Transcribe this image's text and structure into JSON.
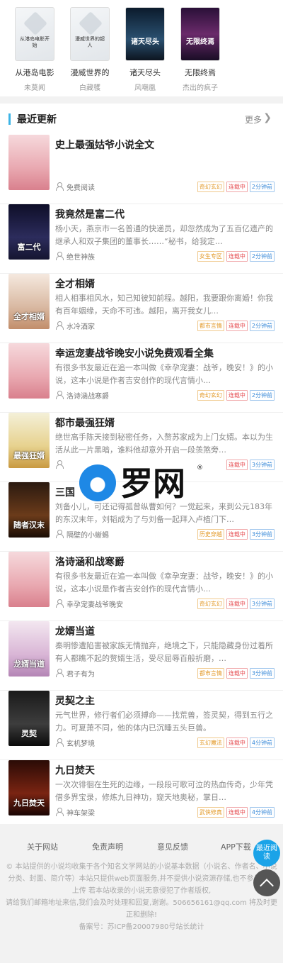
{
  "top_books": [
    {
      "title": "从港岛电影",
      "author": "未莫闻",
      "cover_text": "从港岛电影开始"
    },
    {
      "title": "漫威世界的",
      "author": "白藏鹱",
      "cover_text": "漫威世界的超人"
    },
    {
      "title": "诸天尽头",
      "author": "风嘲凰",
      "cover_text": "诸天尽头"
    },
    {
      "title": "无限终焉",
      "author": "杰出的疯子",
      "cover_text": "无限终焉"
    }
  ],
  "section": {
    "title": "最近更新",
    "more": "更多"
  },
  "books": [
    {
      "title": "史上最强姑爷小说全文",
      "desc": "",
      "author": "免费阅读",
      "category": "奇幻玄幻",
      "status": "连载中",
      "time": "2分钟前",
      "cover_text": ""
    },
    {
      "title": "我竟然是富二代",
      "desc": "杨小天，燕京市一名普通的快递员，却忽然成为了五百亿遗产的继承人和双子集团的董事长……“秘书，给我定…",
      "author": "绝世神族",
      "category": "女生专区",
      "status": "连载中",
      "time": "2分钟前",
      "cover_text": "富二代"
    },
    {
      "title": "全才相婿",
      "desc": "相人相事相风水，知己知彼知前程。越阳，我要跟你离婚！你我有百年姻缘，天命不可违。越阳，离开我女儿…",
      "author": "水冷酒家",
      "category": "都市言情",
      "status": "连载中",
      "time": "2分钟前",
      "cover_text": "全才相婿"
    },
    {
      "title": "幸运宠妻战爷晚安小说免费观看全集",
      "desc": "有很多书友最近在追一本叫做《幸孕宠妻：战爷，晚安！》的小说，这本小说是作者吉安创作的现代言情小…",
      "author": "洛诗涵战寒爵",
      "category": "奇幻玄幻",
      "status": "连载中",
      "time": "2分钟前",
      "cover_text": ""
    },
    {
      "title": "都市最强狂婿",
      "desc": "绝世高手陈天接到秘密任务，入赘苏家成为上门女婿。本以为生活从此一片黑暗，谁料他却意外开启一段羡煞旁…",
      "author": "",
      "category": "",
      "status": "连载中",
      "time": "3分钟前",
      "cover_text": "最强狂婿"
    },
    {
      "title": "三国",
      "desc": "刘备小儿，可还记得孤曾纵曹如何？一觉起来，来到公元183年的东汉末年，刘韬成为了与刘备一起拜入卢植门下…",
      "author": "隔壁的小蜥蜴",
      "category": "历史穿越",
      "status": "连载中",
      "time": "3分钟前",
      "cover_text": "随者汉末"
    },
    {
      "title": "洛诗涵和战寒爵",
      "desc": "有很多书友最近在追一本叫做《幸孕宠妻：战爷，晚安！》的小说，这本小说是作者吉安创作的现代言情小…",
      "author": "幸孕宠妻战爷晚安",
      "category": "奇幻玄幻",
      "status": "连载中",
      "time": "3分钟前",
      "cover_text": ""
    },
    {
      "title": "龙婿当道",
      "desc": "秦明惨遭陷害被家族无情抛弃，绝境之下，只能隐藏身份过着所有人都瞧不起的赘婿生活，受尽屈辱百般折磨，…",
      "author": "君子有为",
      "category": "都市言情",
      "status": "连载中",
      "time": "3分钟前",
      "cover_text": "龙婿当道"
    },
    {
      "title": "灵契之主",
      "desc": "元气世界，修行者们必须搏命——找荒兽，签灵契，得到五行之力。可夏萧不同，他的体内已沉睡五头巨兽。",
      "author": "玄机梦境",
      "category": "玄幻魔法",
      "status": "连载中",
      "time": "4分钟前",
      "cover_text": "灵契"
    },
    {
      "title": "九日焚天",
      "desc": "一次次徘徊在生死的边缘，一段段可歌可泣的热血传奇，少年凭借多界宝录，修炼九日神功，窥天地奥秘，掌日…",
      "author": "神车架梁",
      "category": "武侠修真",
      "status": "连载中",
      "time": "4分钟前",
      "cover_text": "九日焚天"
    }
  ],
  "footer": {
    "links": [
      "关于网站",
      "免责声明",
      "意见反馈",
      "APP下载"
    ],
    "notice": "© 本站提供的小说均收集于各个知名文学网站的小说基本数据（小说名、作者名、小说分类、封面、简介等）本站只提供web页面服务,并不提供小说资源存储,也不参与录制",
    "upload": "上传 若本站收录的小说无意侵犯了作者版权,",
    "contact": "请给我们邮箱地址来信,我们会及时处理和回复,谢谢。506656161@qq.com 将及时更正和删除!",
    "icp": "备案号：苏ICP备20007980号站长统计"
  },
  "watermark": {
    "text": "罗网",
    "reg": "®"
  },
  "float": {
    "read": "最近阅读"
  },
  "colors": {
    "accent": "#3cb4e6",
    "status_red": "#e5484d",
    "category_orange": "#e39a29",
    "time_blue": "#3a8ad8"
  }
}
